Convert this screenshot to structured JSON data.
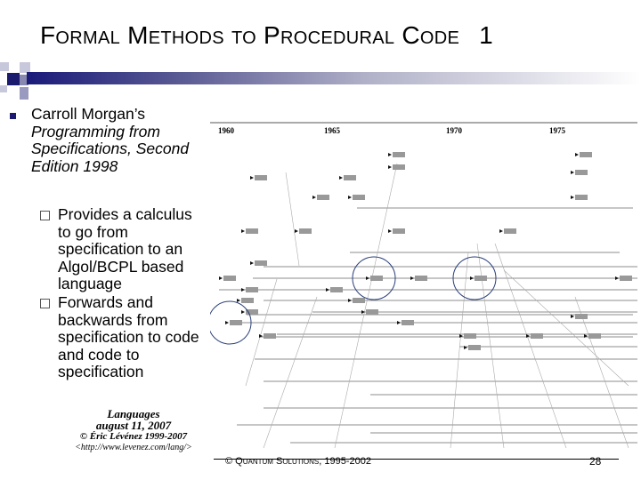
{
  "slide": {
    "title": "Formal Methods to Procedural Code",
    "title_number": "1",
    "bullet": {
      "line1": "Carroll Morgan’s",
      "italic": "Programming from Specifications, Second Edition 1998"
    },
    "sub_bullets": [
      "Provides a calculus to go from specification to an Algol/BCPL based language",
      "Forwards and backwards from specification to code and code to specification"
    ],
    "caption": {
      "title": "Languages",
      "date": "august 11, 2007",
      "copyright": "© Éric Lévénez 1999-2007",
      "url": "<http://www.levenez.com/lang/>"
    },
    "footer": "© Quantum Solutions, 1995-2002",
    "page_number": "28",
    "colors": {
      "accent": "#1a1a7a",
      "circle": "#2a3f7a"
    }
  },
  "diagram": {
    "years": [
      "1960",
      "1965",
      "1970",
      "1975"
    ]
  }
}
